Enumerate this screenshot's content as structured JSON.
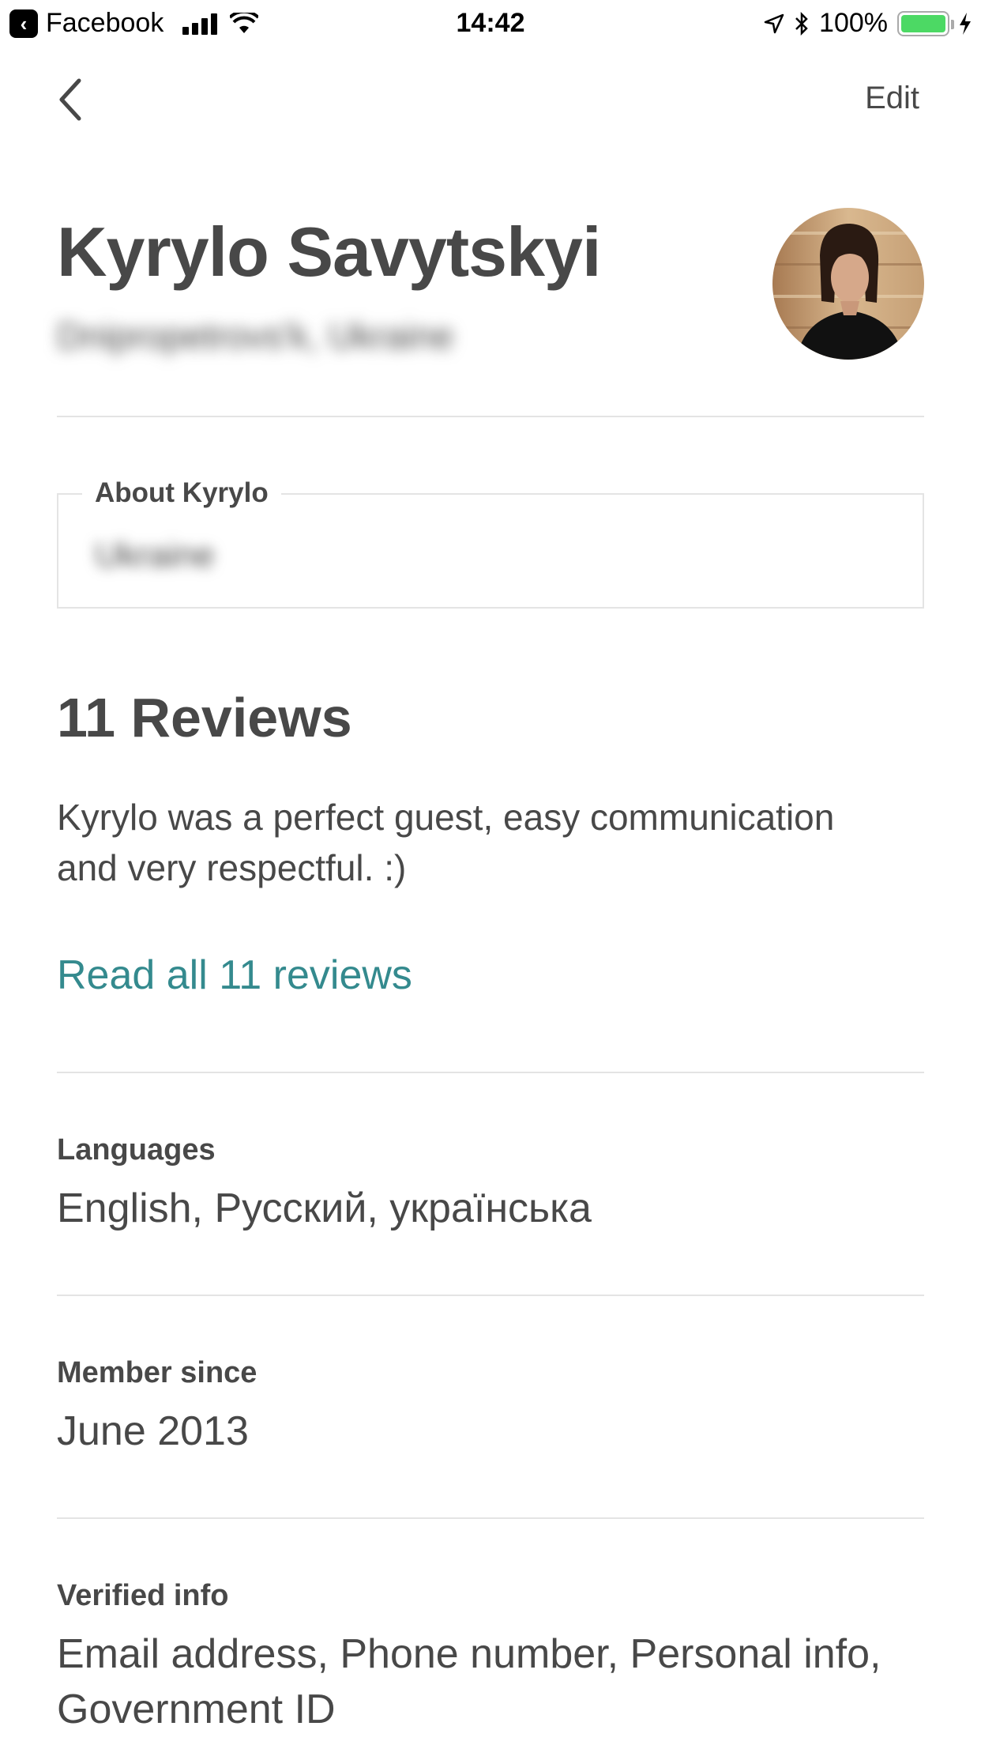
{
  "status_bar": {
    "back_app": "Facebook",
    "time": "14:42",
    "battery": "100%",
    "battery_level": 1.0,
    "battery_color": "#4cd964"
  },
  "nav": {
    "back_icon": "chevron-left-icon",
    "edit_label": "Edit"
  },
  "profile": {
    "name": "Kyrylo Savytskyi",
    "location": "Dnipropetrovs'k, Ukraine"
  },
  "about": {
    "label": "About Kyrylo",
    "text": "Ukraine"
  },
  "reviews": {
    "title": "11 Reviews",
    "excerpt": "Kyrylo was a perfect guest, easy communication and very respectful. :)",
    "read_all": "Read all 11 reviews",
    "link_color": "#348a8e"
  },
  "languages": {
    "label": "Languages",
    "value": "English, Русский, українська"
  },
  "member_since": {
    "label": "Member since",
    "value": "June 2013"
  },
  "verified": {
    "label": "Verified info",
    "value": "Email address, Phone number, Personal info, Government ID"
  }
}
